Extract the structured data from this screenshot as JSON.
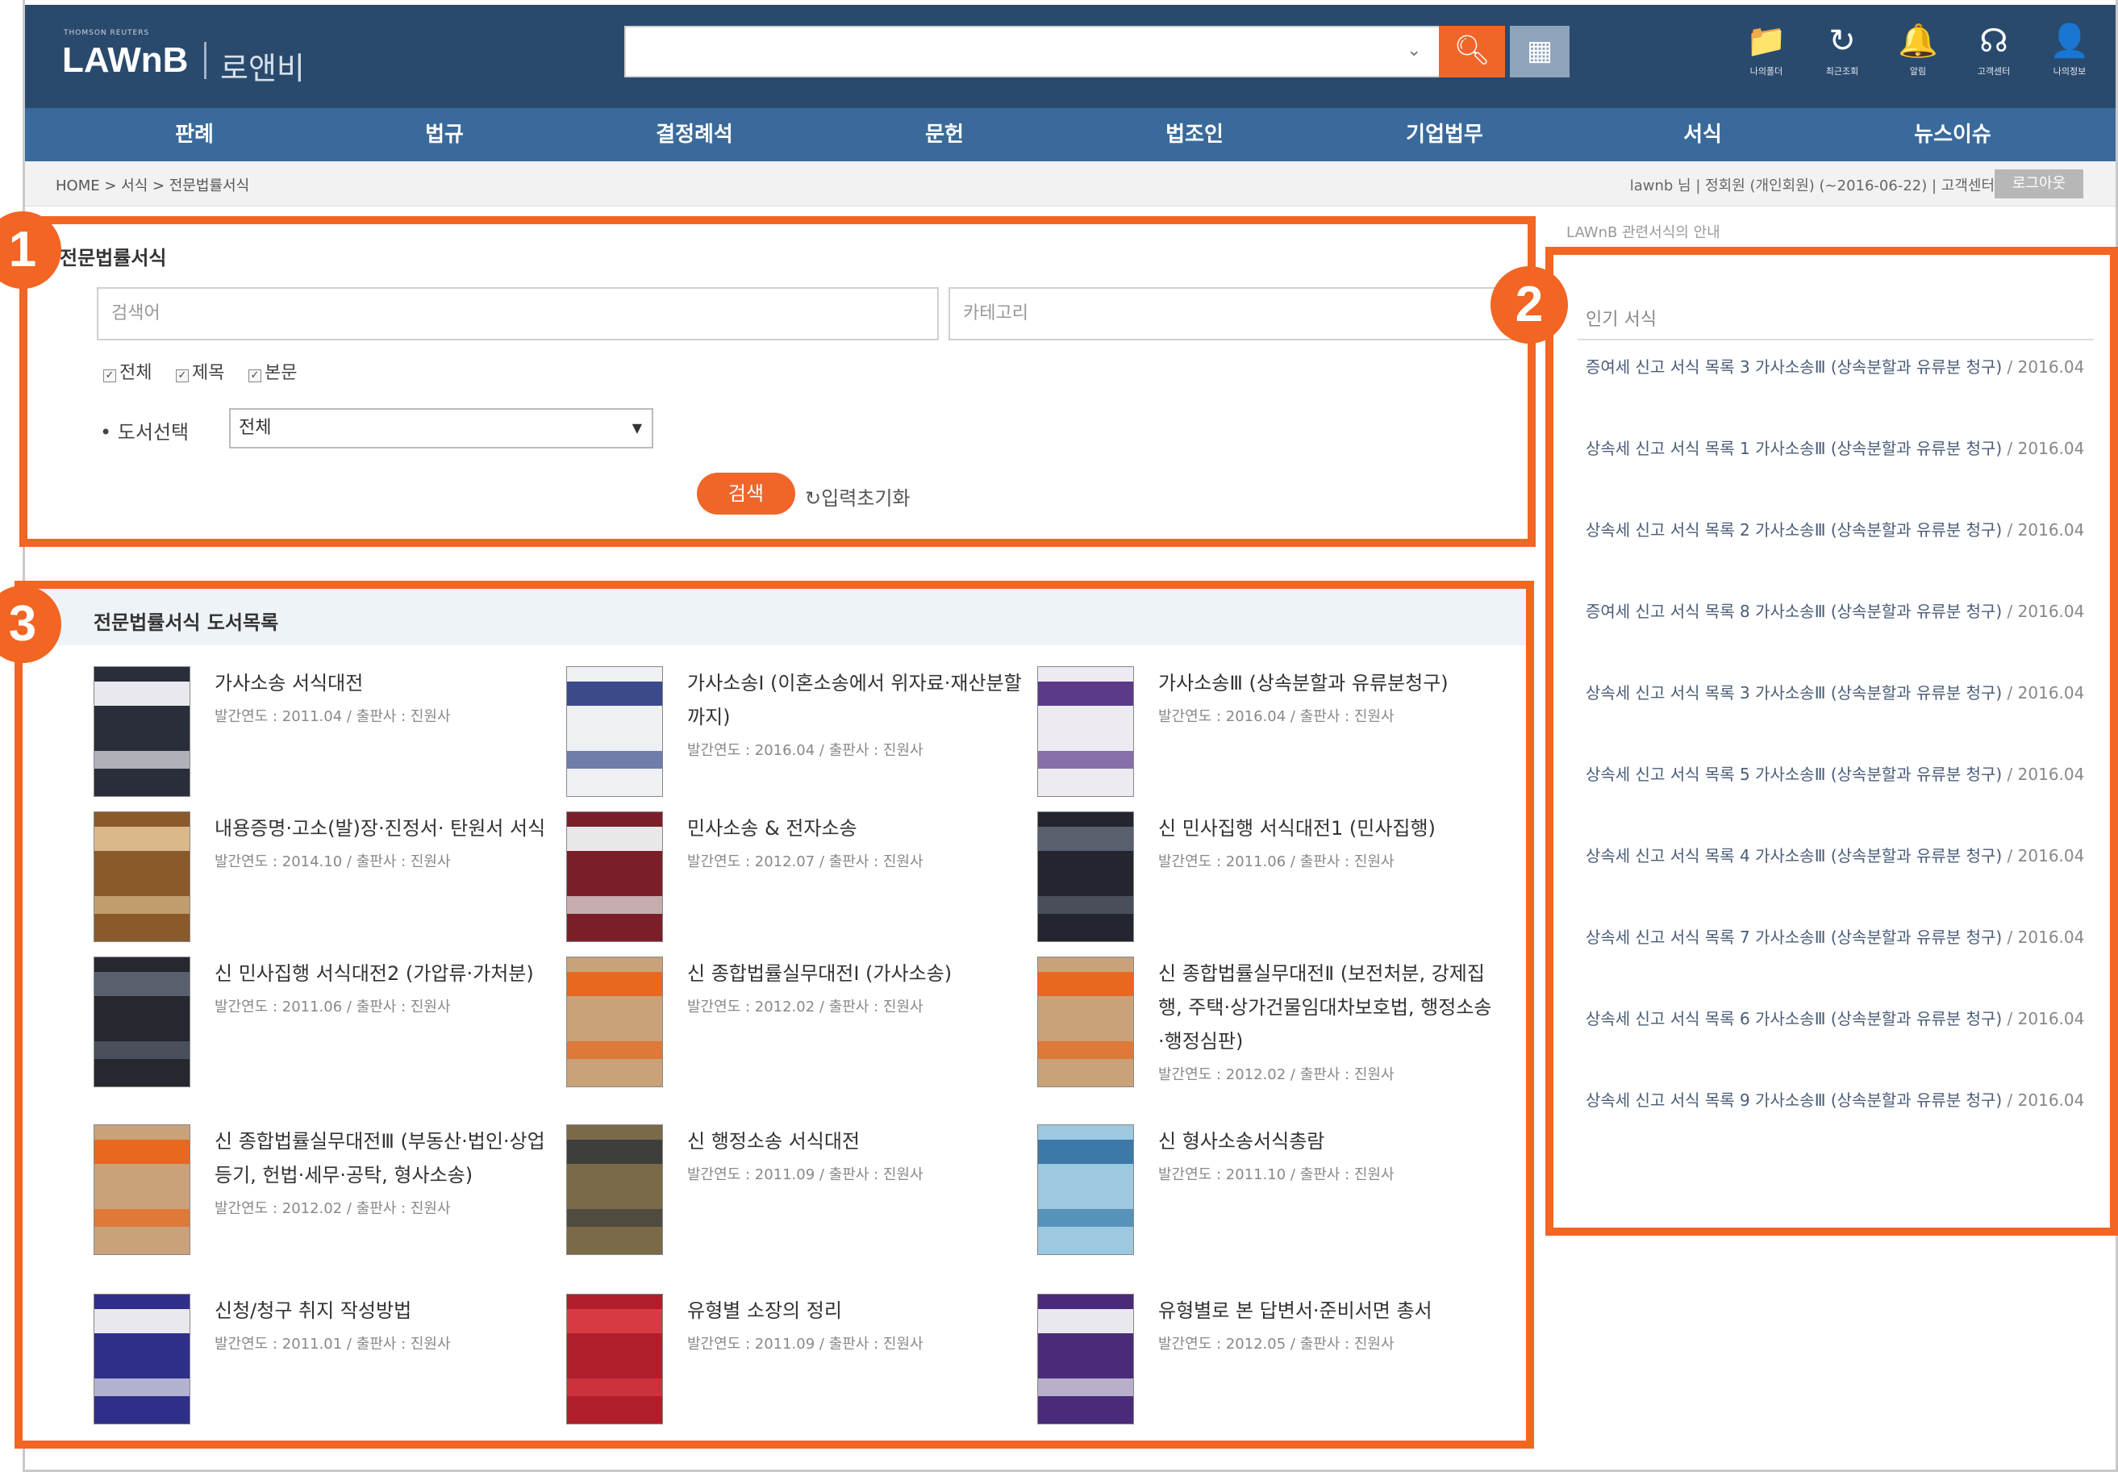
{
  "header": {
    "brand_small": "THOMSON REUTERS",
    "logo": "LAWnB",
    "logo_korean": "로앤비",
    "search_placeholder": "",
    "search_icon": "search-icon",
    "tools": [
      {
        "icon": "folder-icon",
        "glyph": "📁",
        "label": "나의폴더"
      },
      {
        "icon": "history-icon",
        "glyph": "↻",
        "label": "최근조회"
      },
      {
        "icon": "bell-icon",
        "glyph": "🔔",
        "label": "알림"
      },
      {
        "icon": "headset-icon",
        "glyph": "☊",
        "label": "고객센터"
      },
      {
        "icon": "user-icon",
        "glyph": "👤",
        "label": "나의정보"
      }
    ]
  },
  "nav": [
    "판례",
    "법규",
    "결정례석",
    "문헌",
    "법조인",
    "기업법무",
    "서식",
    "뉴스이슈"
  ],
  "breadcrumb": "HOME > 서식 > 전문법률서식",
  "crumb_right": "lawnb 님 | 정회원 (개인회원) (~2016-06-22) | 고객센터",
  "logout_label": "로그아웃",
  "search_section": {
    "title": "전문법률서식",
    "keyword_placeholder": "검색어",
    "category_placeholder": "카테고리",
    "checkboxes": [
      "전체",
      "제목",
      "본문"
    ],
    "book_label": "• 도서선택",
    "book_value": "전체",
    "search_button": "검색",
    "reset_button": "입력초기화"
  },
  "sidebar": {
    "header": "LAWnB 관련서식의 안내",
    "title": "인기 서식",
    "items": [
      {
        "text": "증여세 신고 서식 목록 3 가사소송Ⅲ (상속분할과 유류분 청구)",
        "date": "/ 2016.04"
      },
      {
        "text": "상속세 신고 서식 목록 1 가사소송Ⅲ (상속분할과 유류분 청구)",
        "date": "/ 2016.04"
      },
      {
        "text": "상속세 신고 서식 목록 2 가사소송Ⅲ (상속분할과 유류분 청구)",
        "date": "/ 2016.04"
      },
      {
        "text": "증여세 신고 서식 목록 8 가사소송Ⅲ (상속분할과 유류분 청구)",
        "date": "/ 2016.04"
      },
      {
        "text": "상속세 신고 서식 목록 3 가사소송Ⅲ (상속분할과 유류분 청구)",
        "date": "/ 2016.04"
      },
      {
        "text": "상속세 신고 서식 목록 5 가사소송Ⅲ (상속분할과 유류분 청구)",
        "date": "/ 2016.04"
      },
      {
        "text": "상속세 신고 서식 목록 4 가사소송Ⅲ (상속분할과 유류분 청구)",
        "date": "/ 2016.04"
      },
      {
        "text": "상속세 신고 서식 목록 7 가사소송Ⅲ (상속분할과 유류분 청구)",
        "date": "/ 2016.04"
      },
      {
        "text": "상속세 신고 서식 목록 6 가사소송Ⅲ (상속분할과 유류분 청구)",
        "date": "/ 2016.04"
      },
      {
        "text": "상속세 신고 서식 목록 9 가사소송Ⅲ (상속분할과 유류분 청구)",
        "date": "/ 2016.04"
      }
    ]
  },
  "book_list": {
    "title": "전문법률서식 도서목록",
    "books": [
      {
        "title": "가사소송 서식대전",
        "meta": "발간연도 : 2011.04 / 출판사 : 진원사",
        "cover_color": "#2a2e3a",
        "accent": "#e8e8ee"
      },
      {
        "title": "가사소송Ⅰ (이혼소송에서 위자료·재산분할까지)",
        "meta": "발간연도 : 2016.04 / 출판사 : 진원사",
        "cover_color": "#eef0f4",
        "accent": "#3b4a8a"
      },
      {
        "title": "가사소송Ⅲ (상속분할과 유류분청구)",
        "meta": "발간연도 : 2016.04 / 출판사 : 진원사",
        "cover_color": "#eeeaf2",
        "accent": "#5b3a8a"
      },
      {
        "title": "내용증명·고소(발)장·진정서· 탄원서 서식",
        "meta": "발간연도 : 2014.10 / 출판사 : 진원사",
        "cover_color": "#8a5a2a",
        "accent": "#d9b98a"
      },
      {
        "title": "민사소송 & 전자소송",
        "meta": "발간연도 : 2012.07 / 출판사 : 진원사",
        "cover_color": "#7a1f2a",
        "accent": "#e8e8e8"
      },
      {
        "title": "신 민사집행 서식대전1 (민사집행)",
        "meta": "발간연도 : 2011.06 / 출판사 : 진원사",
        "cover_color": "#23262e",
        "accent": "#5a5f6e"
      },
      {
        "title": "신 민사집행 서식대전2 (가압류·가처분)",
        "meta": "발간연도 : 2011.06 / 출판사 : 진원사",
        "cover_color": "#25282f",
        "accent": "#5a5f6e"
      },
      {
        "title": "신 종합법률실무대전Ⅰ (가사소송)",
        "meta": "발간연도 : 2012.02 / 출판사 : 진원사",
        "cover_color": "#c9a27a",
        "accent": "#e8681f"
      },
      {
        "title": "신 종합법률실무대전Ⅱ (보전처분, 강제집행, 주택·상가건물임대차보호법, 행정소송·행정심판)",
        "meta": "발간연도 : 2012.02 / 출판사 : 진원사",
        "cover_color": "#c9a27a",
        "accent": "#e8681f"
      },
      {
        "title": "신 종합법률실무대전Ⅲ (부동산·법인·상업등기, 헌법·세무·공탁, 형사소송)",
        "meta": "발간연도 : 2012.02 / 출판사 : 진원사",
        "cover_color": "#c9a27a",
        "accent": "#e8681f"
      },
      {
        "title": "신 행정소송 서식대전",
        "meta": "발간연도 : 2011.09 / 출판사 : 진원사",
        "cover_color": "#7a6a4a",
        "accent": "#3e3e3a"
      },
      {
        "title": "신 형사소송서식총람",
        "meta": "발간연도 : 2011.10 / 출판사 : 진원사",
        "cover_color": "#9cc8e0",
        "accent": "#3b7aa8"
      },
      {
        "title": "신청/청구 취지 작성방법",
        "meta": "발간연도 : 2011.01 / 출판사 : 진원사",
        "cover_color": "#2f2f8a",
        "accent": "#e8e8ee"
      },
      {
        "title": "유형별 소장의 정리",
        "meta": "발간연도 : 2011.09 / 출판사 : 진원사",
        "cover_color": "#b01e2c",
        "accent": "#d83a44"
      },
      {
        "title": "유형별로 본 답변서·준비서면 총서",
        "meta": "발간연도 : 2012.05 / 출판사 : 진원사",
        "cover_color": "#4a2a7a",
        "accent": "#e8e8ee"
      }
    ]
  },
  "badges": [
    "1",
    "2",
    "3"
  ],
  "colors": {
    "accent": "#f26522",
    "header": "#2a4a6d",
    "nav": "#3a6a9b"
  }
}
